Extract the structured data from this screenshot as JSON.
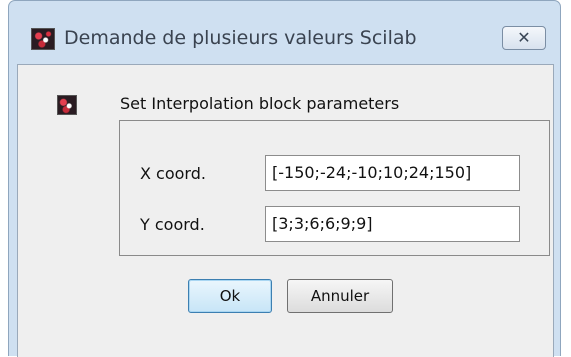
{
  "window": {
    "title": "Demande de plusieurs valeurs Scilab",
    "app_icon": "scilab-icon",
    "close_label": "✕"
  },
  "dialog": {
    "message_icon": "scilab-icon",
    "prompt": "Set Interpolation block parameters",
    "fields": [
      {
        "label": "X coord.",
        "value": "[-150;-24;-10;10;24;150]"
      },
      {
        "label": "Y coord.",
        "value": "[3;3;6;6;9;9]"
      }
    ],
    "buttons": {
      "ok": "Ok",
      "cancel": "Annuler"
    }
  }
}
